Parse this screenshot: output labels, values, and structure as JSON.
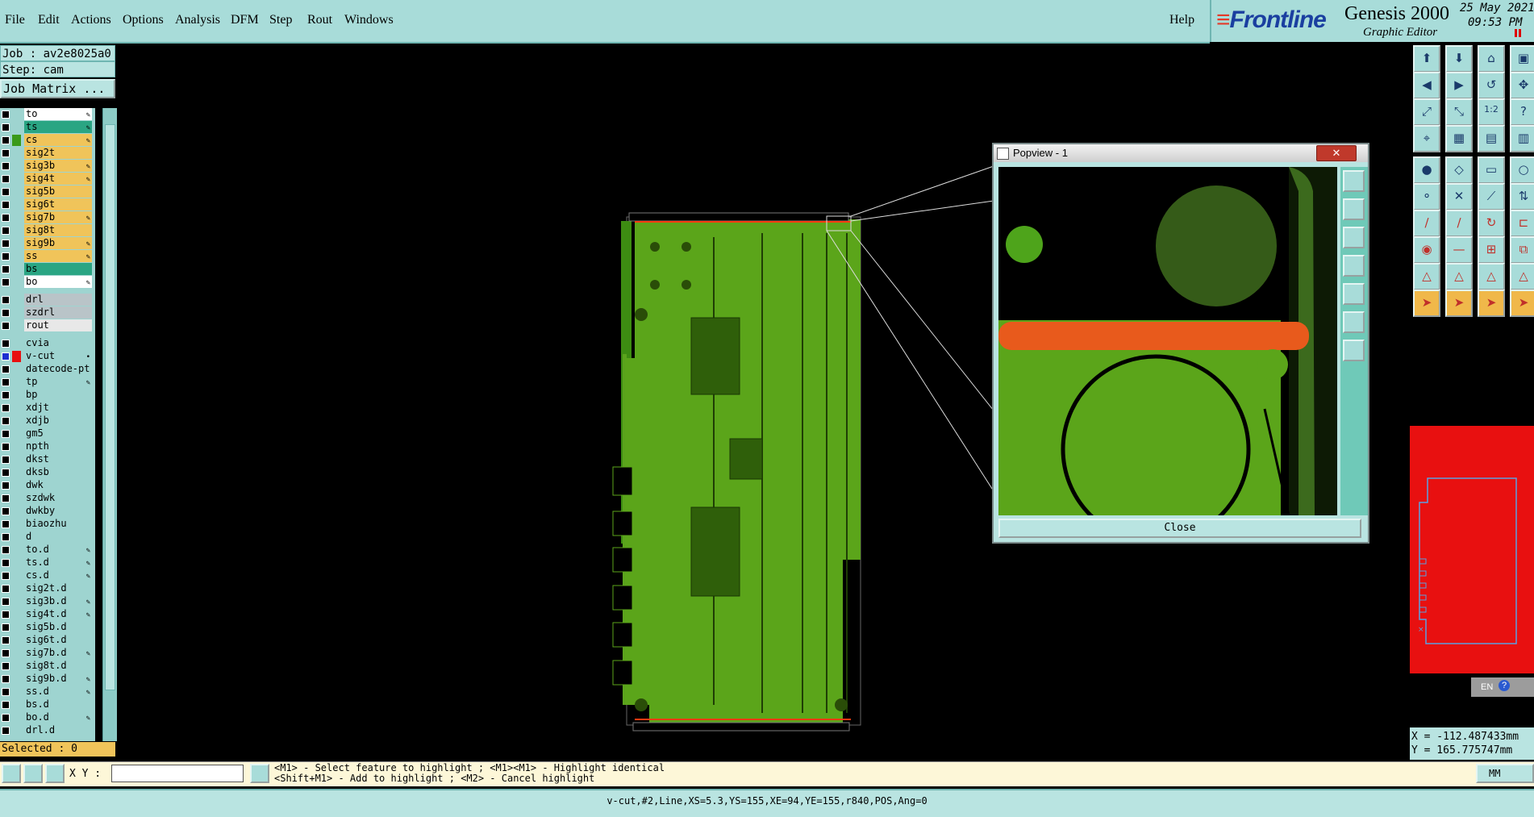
{
  "menu": [
    "File",
    "Edit",
    "Actions",
    "Options",
    "Analysis",
    "DFM",
    "Step",
    "Rout",
    "Windows"
  ],
  "help": "Help",
  "brand": {
    "logo": "Frontline",
    "product": "Genesis 2000",
    "subtitle": "Graphic Editor",
    "date": "25 May 2021",
    "time": "09:53 PM"
  },
  "job": {
    "line": "Job : av2e8025a0",
    "step": "Step: cam",
    "matrix_button": "Job Matrix ..."
  },
  "layers": [
    {
      "name": "to",
      "color": "#ffffff",
      "mark": "edit"
    },
    {
      "name": "ts",
      "color": "#2aa583",
      "mark": "edit"
    },
    {
      "name": "cs",
      "color": "#f0c45a",
      "mark": "edit",
      "swatch": "#3a9a1a"
    },
    {
      "name": "sig2t",
      "color": "#f0c45a",
      "mark": ""
    },
    {
      "name": "sig3b",
      "color": "#f0c45a",
      "mark": "edit"
    },
    {
      "name": "sig4t",
      "color": "#f0c45a",
      "mark": "edit"
    },
    {
      "name": "sig5b",
      "color": "#f0c45a",
      "mark": ""
    },
    {
      "name": "sig6t",
      "color": "#f0c45a",
      "mark": ""
    },
    {
      "name": "sig7b",
      "color": "#f0c45a",
      "mark": "edit"
    },
    {
      "name": "sig8t",
      "color": "#f0c45a",
      "mark": ""
    },
    {
      "name": "sig9b",
      "color": "#f0c45a",
      "mark": "edit"
    },
    {
      "name": "ss",
      "color": "#f0c45a",
      "mark": "edit"
    },
    {
      "name": "bs",
      "color": "#2aa583",
      "mark": ""
    },
    {
      "name": "bo",
      "color": "#ffffff",
      "mark": "edit"
    },
    {
      "name": "drl",
      "color": "#b9c4c8",
      "mark": ""
    },
    {
      "name": "szdrl",
      "color": "#b9c4c8",
      "mark": ""
    },
    {
      "name": "rout",
      "color": "#e8e8e8",
      "mark": ""
    },
    {
      "name": "cvia",
      "color": "#9ed4d0",
      "mark": ""
    },
    {
      "name": "v-cut",
      "color": "#9ed4d0",
      "mark": "dot",
      "check": "#1c2fd0",
      "swatch": "#e81010"
    },
    {
      "name": "datecode-pt",
      "color": "#9ed4d0",
      "mark": ""
    },
    {
      "name": "tp",
      "color": "#9ed4d0",
      "mark": "edit"
    },
    {
      "name": "bp",
      "color": "#9ed4d0",
      "mark": ""
    },
    {
      "name": "xdjt",
      "color": "#9ed4d0",
      "mark": ""
    },
    {
      "name": "xdjb",
      "color": "#9ed4d0",
      "mark": ""
    },
    {
      "name": "gm5",
      "color": "#9ed4d0",
      "mark": ""
    },
    {
      "name": "npth",
      "color": "#9ed4d0",
      "mark": ""
    },
    {
      "name": "dkst",
      "color": "#9ed4d0",
      "mark": ""
    },
    {
      "name": "dksb",
      "color": "#9ed4d0",
      "mark": ""
    },
    {
      "name": "dwk",
      "color": "#9ed4d0",
      "mark": ""
    },
    {
      "name": "szdwk",
      "color": "#9ed4d0",
      "mark": ""
    },
    {
      "name": "dwkby",
      "color": "#9ed4d0",
      "mark": ""
    },
    {
      "name": "biaozhu",
      "color": "#9ed4d0",
      "mark": ""
    },
    {
      "name": "d",
      "color": "#9ed4d0",
      "mark": ""
    },
    {
      "name": "to.d",
      "color": "#9ed4d0",
      "mark": "edit"
    },
    {
      "name": "ts.d",
      "color": "#9ed4d0",
      "mark": "edit"
    },
    {
      "name": "cs.d",
      "color": "#9ed4d0",
      "mark": "edit"
    },
    {
      "name": "sig2t.d",
      "color": "#9ed4d0",
      "mark": ""
    },
    {
      "name": "sig3b.d",
      "color": "#9ed4d0",
      "mark": "edit"
    },
    {
      "name": "sig4t.d",
      "color": "#9ed4d0",
      "mark": "edit"
    },
    {
      "name": "sig5b.d",
      "color": "#9ed4d0",
      "mark": ""
    },
    {
      "name": "sig6t.d",
      "color": "#9ed4d0",
      "mark": ""
    },
    {
      "name": "sig7b.d",
      "color": "#9ed4d0",
      "mark": "edit"
    },
    {
      "name": "sig8t.d",
      "color": "#9ed4d0",
      "mark": ""
    },
    {
      "name": "sig9b.d",
      "color": "#9ed4d0",
      "mark": "edit"
    },
    {
      "name": "ss.d",
      "color": "#9ed4d0",
      "mark": "edit"
    },
    {
      "name": "bs.d",
      "color": "#9ed4d0",
      "mark": ""
    },
    {
      "name": "bo.d",
      "color": "#9ed4d0",
      "mark": "edit"
    },
    {
      "name": "drl.d",
      "color": "#9ed4d0",
      "mark": ""
    }
  ],
  "selected": "Selected : 0",
  "popview": {
    "title": "Popview - 1",
    "close_button": "Close"
  },
  "toolbar_icons": [
    "undo-icon",
    "redo-icon",
    "home-icon",
    "window-icon",
    "prev-icon",
    "next-icon",
    "zoom-back-icon",
    "pan-icon",
    "fit-icon",
    "fit-all-icon",
    "one-to-one-icon",
    "help-icon",
    "snap-icon",
    "grid-icon",
    "layer-a-icon",
    "layer-b-icon",
    "measure-icon",
    "shape-icon",
    "ruler-icon",
    "pad-icon",
    "net-icon",
    "cross-icon",
    "connect-icon",
    "link-icon",
    "line-icon",
    "slash-icon",
    "arc-icon",
    "text-icon",
    "point-icon",
    "minus-icon",
    "step-icon",
    "copy-icon",
    "triangle-icon",
    "triangle-a-icon",
    "triangle-b-icon",
    "triangle-c-icon",
    "pointer-icon",
    "pointer-b-icon",
    "pointer-c-icon",
    "pointer-d-icon"
  ],
  "language": "EN",
  "coords": {
    "x": "X = -112.487433mm",
    "y": "Y = 165.775747mm"
  },
  "command": {
    "xy_label": "X Y :",
    "xy_value": "",
    "hint_line1": "<M1> - Select feature to highlight ; <M1><M1> - Highlight identical",
    "hint_line2": "<Shift+M1> - Add to highlight ; <M2> - Cancel highlight",
    "unit": "MM"
  },
  "status": "v-cut,#2,Line,XS=5.3,YS=155,XE=94,YE=155,r840,POS,Ang=0"
}
